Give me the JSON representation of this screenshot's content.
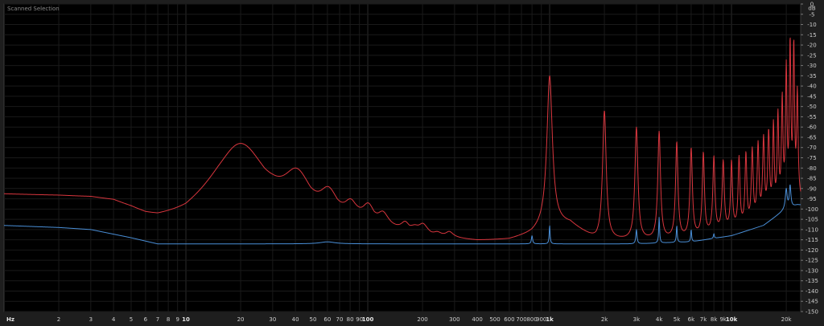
{
  "window": {
    "title": "Scanned Selection"
  },
  "chart_data": {
    "type": "line",
    "title": "Scanned Selection",
    "xscale": "log",
    "xlim": [
      1,
      24000
    ],
    "ylim": [
      -150,
      0
    ],
    "yunit": "dB",
    "grid": true,
    "x_ticks": [
      {
        "v": 1,
        "label": "Hz",
        "bold": true
      },
      {
        "v": 2,
        "label": "2"
      },
      {
        "v": 3,
        "label": "3"
      },
      {
        "v": 4,
        "label": "4"
      },
      {
        "v": 5,
        "label": "5"
      },
      {
        "v": 6,
        "label": "6"
      },
      {
        "v": 7,
        "label": "7"
      },
      {
        "v": 8,
        "label": "8"
      },
      {
        "v": 9,
        "label": "9"
      },
      {
        "v": 10,
        "label": "10",
        "bold": true
      },
      {
        "v": 20,
        "label": "20"
      },
      {
        "v": 30,
        "label": "30"
      },
      {
        "v": 40,
        "label": "40"
      },
      {
        "v": 50,
        "label": "50"
      },
      {
        "v": 60,
        "label": "60"
      },
      {
        "v": 70,
        "label": "70"
      },
      {
        "v": 80,
        "label": "80"
      },
      {
        "v": 90,
        "label": "90"
      },
      {
        "v": 100,
        "label": "100",
        "bold": true
      },
      {
        "v": 200,
        "label": "200"
      },
      {
        "v": 300,
        "label": "300"
      },
      {
        "v": 400,
        "label": "400"
      },
      {
        "v": 500,
        "label": "500"
      },
      {
        "v": 600,
        "label": "600"
      },
      {
        "v": 700,
        "label": "700"
      },
      {
        "v": 800,
        "label": "800"
      },
      {
        "v": 900,
        "label": "900"
      },
      {
        "v": 1000,
        "label": "1k",
        "bold": true
      },
      {
        "v": 2000,
        "label": "2k"
      },
      {
        "v": 3000,
        "label": "3k"
      },
      {
        "v": 4000,
        "label": "4k"
      },
      {
        "v": 5000,
        "label": "5k"
      },
      {
        "v": 6000,
        "label": "6k"
      },
      {
        "v": 7000,
        "label": "7k"
      },
      {
        "v": 8000,
        "label": "8k"
      },
      {
        "v": 9000,
        "label": "9k"
      },
      {
        "v": 10000,
        "label": "10k",
        "bold": true
      },
      {
        "v": 20000,
        "label": "20k"
      }
    ],
    "y_ticks": [
      "dB",
      "0",
      "-5",
      "-10",
      "-15",
      "-20",
      "-25",
      "-30",
      "-35",
      "-40",
      "-45",
      "-50",
      "-55",
      "-60",
      "-65",
      "-70",
      "-75",
      "-80",
      "-85",
      "-90",
      "-95",
      "-100",
      "-105",
      "-110",
      "-115",
      "-120",
      "-125",
      "-130",
      "-135",
      "-140",
      "-145",
      "-150"
    ],
    "series": [
      {
        "color": "#d9363e",
        "baseline": [
          [
            1,
            -93
          ],
          [
            2,
            -94
          ],
          [
            3,
            -95
          ],
          [
            4,
            -97
          ],
          [
            5,
            -101
          ],
          [
            6,
            -105
          ],
          [
            7,
            -107
          ],
          [
            10,
            -107
          ],
          [
            12,
            -104
          ],
          [
            15,
            -100
          ],
          [
            30,
            -100
          ],
          [
            60,
            -109
          ],
          [
            100,
            -112
          ],
          [
            200,
            -116
          ],
          [
            400,
            -117
          ],
          [
            600,
            -116
          ],
          [
            800,
            -113
          ],
          [
            1000,
            -108
          ],
          [
            1300,
            -108
          ],
          [
            1800,
            -116
          ],
          [
            2500,
            -116
          ],
          [
            4000,
            -116
          ],
          [
            6000,
            -115
          ],
          [
            9000,
            -112
          ],
          [
            12000,
            -110
          ],
          [
            16000,
            -105
          ],
          [
            20000,
            -100
          ],
          [
            23000,
            -98
          ]
        ],
        "peaks": [
          [
            20,
            -68,
            0.17
          ],
          [
            40,
            -80,
            0.09
          ],
          [
            60,
            -89,
            0.06
          ],
          [
            80,
            -95,
            0.045
          ],
          [
            100,
            -97,
            0.04
          ],
          [
            120,
            -101,
            0.035
          ],
          [
            160,
            -106,
            0.03
          ],
          [
            180,
            -108,
            0.03
          ],
          [
            200,
            -107,
            0.03
          ],
          [
            240,
            -111,
            0.025
          ],
          [
            280,
            -111,
            0.025
          ],
          [
            1000,
            -35,
            0.018
          ],
          [
            2000,
            -52,
            0.012
          ],
          [
            3000,
            -60,
            0.01
          ],
          [
            4000,
            -62,
            0.009
          ],
          [
            5000,
            -67,
            0.008
          ],
          [
            6000,
            -70,
            0.008
          ],
          [
            7000,
            -72,
            0.007
          ],
          [
            8000,
            -74,
            0.007
          ],
          [
            9000,
            -76,
            0.007
          ],
          [
            10000,
            -76,
            0.006
          ],
          [
            11000,
            -74,
            0.006
          ],
          [
            12000,
            -72,
            0.006
          ],
          [
            13000,
            -70,
            0.006
          ],
          [
            14000,
            -67,
            0.006
          ],
          [
            15000,
            -64,
            0.006
          ],
          [
            16000,
            -61,
            0.006
          ],
          [
            17000,
            -57,
            0.005
          ],
          [
            18000,
            -52,
            0.005
          ],
          [
            19000,
            -44,
            0.005
          ],
          [
            20000,
            -28,
            0.005
          ],
          [
            21000,
            -15,
            0.005
          ],
          [
            22000,
            -16,
            0.005
          ],
          [
            23000,
            -40,
            0.005
          ]
        ]
      },
      {
        "color": "#4a8fd8",
        "baseline": [
          [
            1,
            -108
          ],
          [
            2,
            -109
          ],
          [
            3,
            -110
          ],
          [
            5,
            -114
          ],
          [
            7,
            -117
          ],
          [
            10,
            -117
          ],
          [
            100,
            -117
          ],
          [
            1000,
            -117
          ],
          [
            3000,
            -117
          ],
          [
            6000,
            -116
          ],
          [
            10000,
            -113
          ],
          [
            15000,
            -108
          ],
          [
            20000,
            -100
          ],
          [
            23000,
            -98
          ]
        ],
        "peaks": [
          [
            60,
            -116,
            0.05
          ],
          [
            800,
            -113,
            0.004
          ],
          [
            1000,
            -108,
            0.003
          ],
          [
            3000,
            -110,
            0.004
          ],
          [
            4000,
            -104,
            0.003
          ],
          [
            5000,
            -108,
            0.003
          ],
          [
            6000,
            -110,
            0.003
          ],
          [
            8000,
            -112,
            0.003
          ],
          [
            20000,
            -90,
            0.006
          ],
          [
            21000,
            -88,
            0.005
          ]
        ]
      }
    ]
  }
}
